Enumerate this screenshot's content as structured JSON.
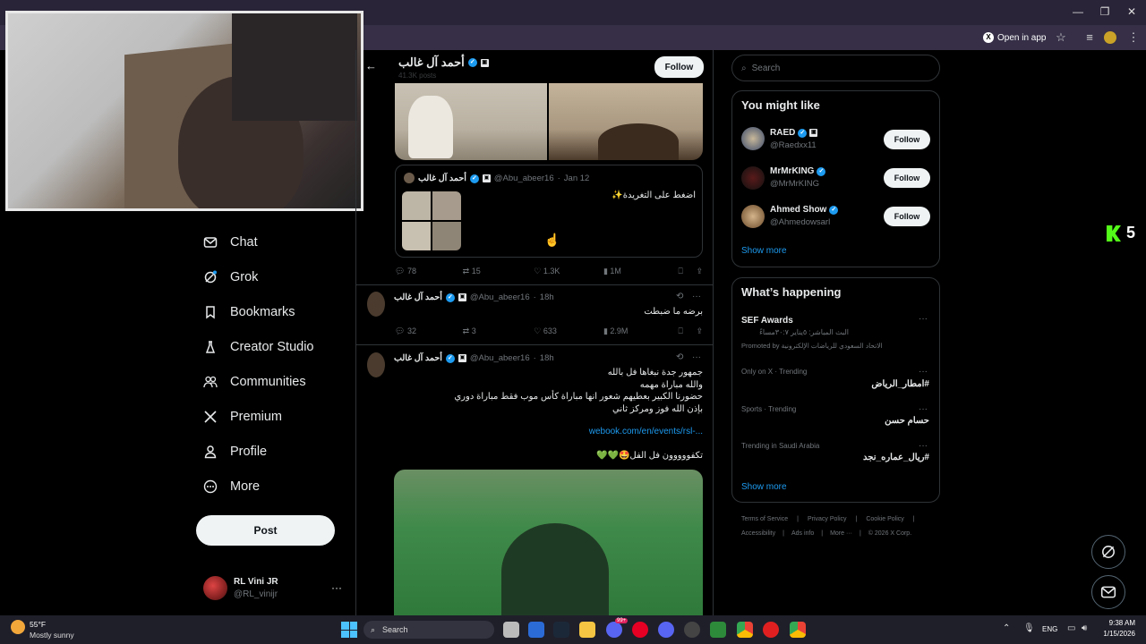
{
  "browser": {
    "open_in_app": "Open in app"
  },
  "nav": {
    "items": [
      {
        "label": "Chat"
      },
      {
        "label": "Grok"
      },
      {
        "label": "Bookmarks"
      },
      {
        "label": "Creator Studio"
      },
      {
        "label": "Communities"
      },
      {
        "label": "Premium"
      },
      {
        "label": "Profile"
      },
      {
        "label": "More"
      }
    ],
    "post_label": "Post",
    "account": {
      "name": "RL Vini JR",
      "handle": "@RL_vinijr"
    }
  },
  "profile_header": {
    "name": "أحمد آل غالب",
    "posts": "41.3K posts",
    "follow_label": "Follow"
  },
  "tweets": [
    {
      "quote": {
        "name": "أحمد آل غالب",
        "handle": "@Abu_abeer16",
        "date": "Jan 12",
        "text": "اضغط على التغريدة✨"
      },
      "replies": "78",
      "reposts": "15",
      "likes": "1.3K",
      "views": "1M"
    },
    {
      "name": "أحمد آل غالب",
      "handle": "@Abu_abeer16",
      "time": "18h",
      "text": "برضه ما ضبطت",
      "replies": "32",
      "reposts": "3",
      "likes": "633",
      "views": "2.9M"
    },
    {
      "name": "أحمد آل غالب",
      "handle": "@Abu_abeer16",
      "time": "18h",
      "lines": [
        "جمهور جدة نبغاها فل بالله",
        "والله مباراة مهمه",
        "حضورنا الكبير بعطيهم شعور انها مباراة كأس موب فقط مباراة دوري",
        "بإذن الله فوز ومركز ثاني"
      ],
      "link": "webook.com/en/events/rsl-...",
      "footer": "تكفووووون فل الفل🤩💚💚"
    }
  ],
  "search": {
    "placeholder": "Search"
  },
  "you_might_like": {
    "title": "You might like",
    "users": [
      {
        "name": "RAED",
        "handle": "@Raedxx11",
        "follow": "Follow"
      },
      {
        "name": "MrMrKING",
        "handle": "@MrMrKING",
        "follow": "Follow"
      },
      {
        "name": "Ahmed Show",
        "handle": "@Ahmedowsarl",
        "follow": "Follow"
      }
    ],
    "show_more": "Show more"
  },
  "whats_happening": {
    "title": "What’s happening",
    "promo": {
      "title": "SEF Awards",
      "subtitle": "البث المباشر: ٥يناير ٣٠:٧مساءً",
      "promoted": "Promoted by الاتحاد السعودي للرياضات الإلكترونية"
    },
    "trends": [
      {
        "meta": "Only on X · Trending",
        "title": "#امطار_الرياض"
      },
      {
        "meta": "Sports · Trending",
        "title": "حسام حسن"
      },
      {
        "meta": "Trending in Saudi Arabia",
        "title": "#ريال_عماره_نجد"
      }
    ],
    "show_more": "Show more"
  },
  "footer_links": {
    "row1": [
      "Terms of Service",
      "Privacy Policy",
      "Cookie Policy"
    ],
    "row2": [
      "Accessibility",
      "Ads info",
      "More ···",
      "© 2026 X Corp."
    ]
  },
  "taskbar": {
    "weather_temp": "55°F",
    "weather_desc": "Mostly sunny",
    "search_label": "Search",
    "lang": "ENG",
    "time": "9:38 AM",
    "date": "1/15/2026",
    "badge_count": "99+"
  },
  "overlay": {
    "kick_number": "5"
  },
  "colors": {
    "accent": "#1d9bf0",
    "kick_green": "#53fc18",
    "background": "#000000"
  }
}
